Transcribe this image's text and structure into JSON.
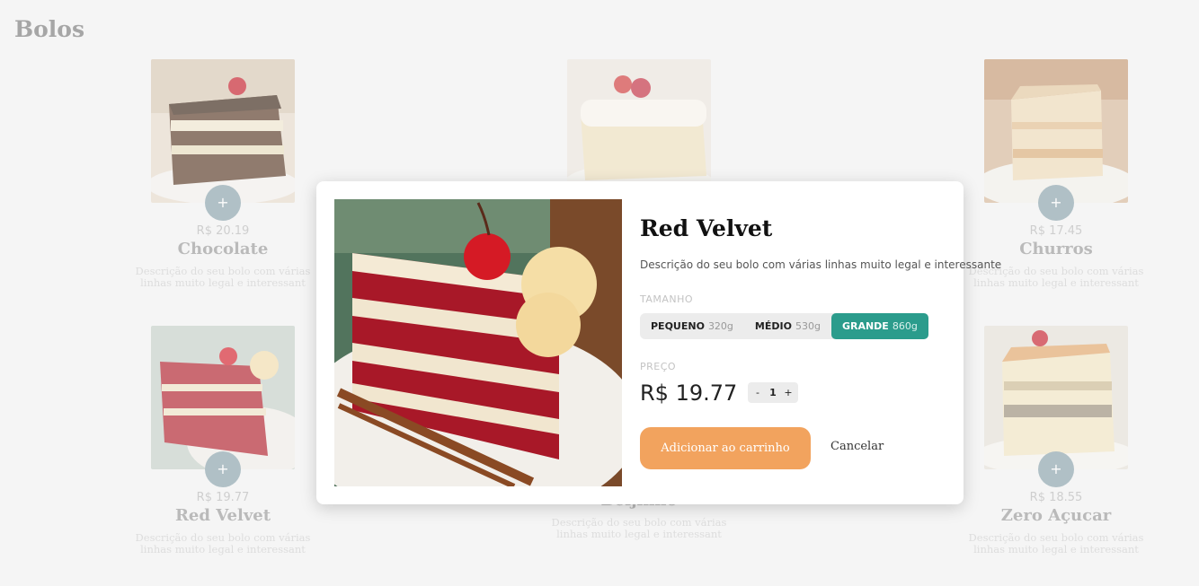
{
  "page": {
    "title": "Bolos"
  },
  "products": [
    {
      "name": "Chocolate",
      "price": "R$ 20.19",
      "description": "Descrição do seu bolo com várias linhas muito legal e interessant",
      "add_label": "+"
    },
    {
      "name": "",
      "price": "",
      "description": "",
      "add_label": ""
    },
    {
      "name": "Churros",
      "price": "R$ 17.45",
      "description": "Descrição do seu bolo com várias linhas muito legal e interessant",
      "add_label": "+"
    },
    {
      "name": "Red Velvet",
      "price": "R$ 19.77",
      "description": "Descrição do seu bolo com várias linhas muito legal e interessant",
      "add_label": "+"
    },
    {
      "name": "Beijinho",
      "price": "",
      "description": "Descrição do seu bolo com várias linhas muito legal e interessant",
      "add_label": ""
    },
    {
      "name": "Zero Açucar",
      "price": "R$ 18.55",
      "description": "Descrição do seu bolo com várias linhas muito legal e interessant",
      "add_label": "+"
    }
  ],
  "modal": {
    "title": "Red Velvet",
    "description": "Descrição do seu bolo com várias linhas muito legal e interessante",
    "size_label": "TAMANHO",
    "sizes": [
      {
        "name": "PEQUENO",
        "weight": "320g"
      },
      {
        "name": "MÉDIO",
        "weight": "530g"
      },
      {
        "name": "GRANDE",
        "weight": "860g"
      }
    ],
    "selected_size": "GRANDE",
    "price_label": "PREÇO",
    "price": "R$ 19.77",
    "quantity": {
      "minus": "-",
      "value": "1",
      "plus": "+"
    },
    "add_to_cart_label": "Adicionar ao carrinho",
    "cancel_label": "Cancelar"
  },
  "colors": {
    "accent_orange": "#f2a35e",
    "selected_teal": "#2b9c8c",
    "add_button": "#8aa3ad"
  },
  "icons": {
    "add": "plus-icon"
  }
}
